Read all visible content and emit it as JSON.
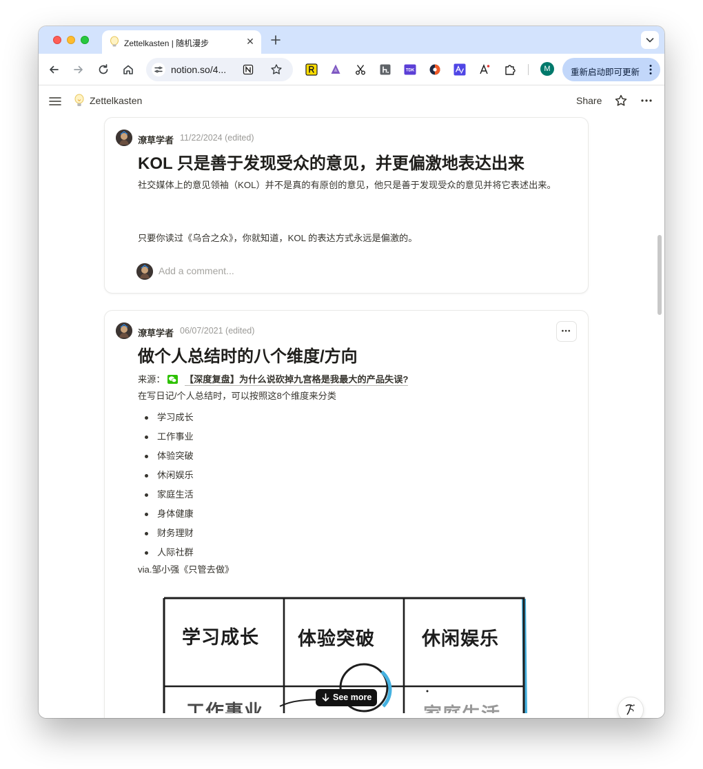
{
  "browser": {
    "tab": {
      "title": "Zettelkasten | 随机漫步",
      "favicon": "lightbulb-icon"
    },
    "address_bar": {
      "url": "notion.so/4..."
    },
    "update_button": {
      "label": "重新启动即可更新"
    },
    "profile": {
      "initial": "M"
    },
    "extensions": [
      "reader-extension-icon",
      "sparkle-extension-icon",
      "scissors-extension-icon",
      "h-extension-icon",
      "tdk-extension-icon",
      "half-circle-extension-icon",
      "translate-extension-icon",
      "font-extension-icon",
      "puzzle-icon"
    ]
  },
  "notion_header": {
    "page_icon": "lightbulb-icon",
    "page_title": "Zettelkasten",
    "share_label": "Share"
  },
  "cards": [
    {
      "author": "潦草学者",
      "date": "11/22/2024 (edited)",
      "title": "KOL 只是善于发现受众的意见，并更偏激地表达出来",
      "paragraphs": [
        "社交媒体上的意见领袖（KOL）并不是真的有原创的意见，他只是善于发现受众的意见并将它表述出来。",
        "只要你读过《乌合之众》，你就知道，KOL 的表达方式永远是偏激的。"
      ],
      "comment_placeholder": "Add a comment..."
    },
    {
      "author": "潦草学者",
      "date": "06/07/2021 (edited)",
      "title": "做个人总结时的八个维度/方向",
      "source_label": "来源：",
      "source_link": "【深度复盘】为什么说砍掉九宫格是我最大的产品失误?",
      "intro": "在写日记/个人总结时，可以按照这8个维度来分类",
      "items": [
        "学习成长",
        "工作事业",
        "体验突破",
        "休闲娱乐",
        "家庭生活",
        "身体健康",
        "财务理财",
        "人际社群"
      ],
      "via": "via.邹小强《只管去做》",
      "sketch_labels": [
        "学习成长",
        "体验突破",
        "休闲娱乐",
        "工作事业",
        "家庭生活"
      ],
      "see_more_label": "See more"
    }
  ],
  "colors": {
    "tab_strip": "#d3e3fd",
    "update_button": "#c2d7fa",
    "text": "#37352f",
    "muted": "#9b9a97",
    "accent_sketch_blue": "#45b1e0"
  }
}
